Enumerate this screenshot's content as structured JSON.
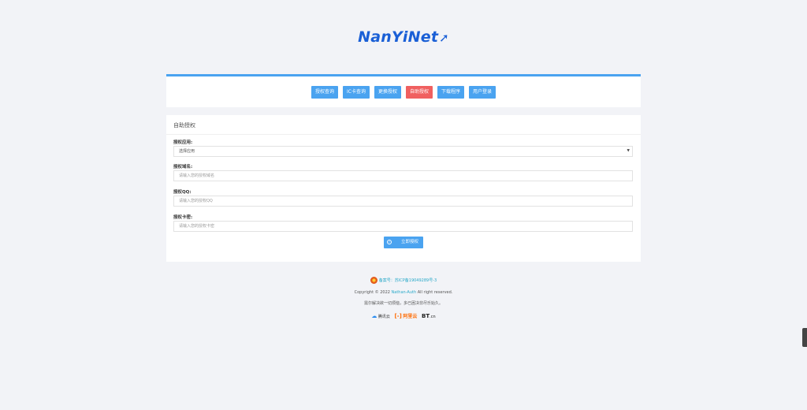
{
  "brand": {
    "logo_text": "NanYiNet",
    "logo_arrow": "➚"
  },
  "nav": {
    "buttons": [
      {
        "label": "授权查询",
        "active": false
      },
      {
        "label": "IC卡查询",
        "active": false
      },
      {
        "label": "更换授权",
        "active": false
      },
      {
        "label": "自助授权",
        "active": true
      },
      {
        "label": "下载程序",
        "active": false
      },
      {
        "label": "用户登录",
        "active": false
      }
    ]
  },
  "form": {
    "title": "自助授权",
    "app_label": "授权应用:",
    "app_value": "选择应用",
    "domain_label": "授权域名:",
    "domain_placeholder": "请输入您的授权域名",
    "qq_label": "授权QQ:",
    "qq_placeholder": "请输入您的授权QQ",
    "card_label": "授权卡密:",
    "card_placeholder": "请输入您的授权卡密",
    "submit_label": "立即授权"
  },
  "footer": {
    "icp_text": "备案号：苏ICP备19049289号-3",
    "copyright_prefix": "Copyright © 2022",
    "copyright_link": "Nathan-Auth",
    "copyright_suffix": "All right reserved.",
    "slogan": "需尔解决欲一切烦恼，多已困决非尽乐始久。",
    "partners": {
      "tencent": "腾讯云",
      "aliyun_icon": "[-]",
      "aliyun": "阿里云",
      "bt": "BT",
      "bt_cn": ".cn"
    }
  },
  "colors": {
    "primary": "#4aa3f0",
    "active": "#f06060",
    "link": "#2aa9c9",
    "logo": "#1a5fd6"
  }
}
